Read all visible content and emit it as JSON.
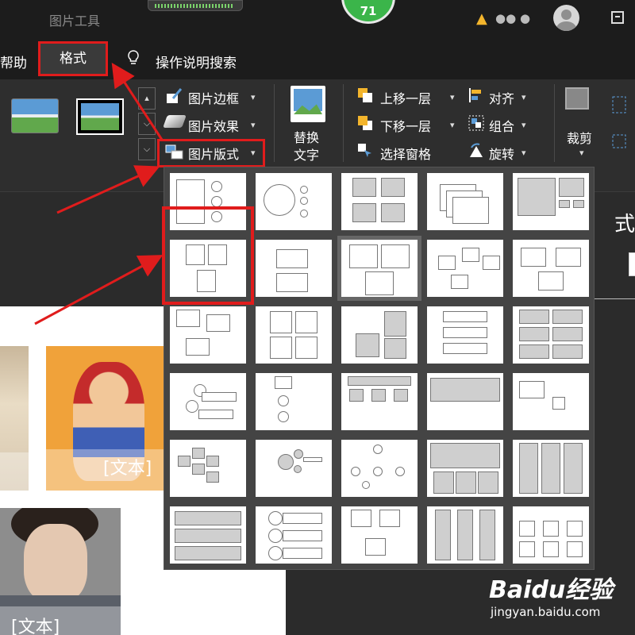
{
  "titlebar": {
    "tool_label": "图片工具",
    "score": "71",
    "user_name": "●● ●"
  },
  "menu": {
    "help": "帮助",
    "format": "格式",
    "search": "操作说明搜索"
  },
  "ribbon": {
    "border": "图片边框",
    "effects": "图片效果",
    "layout": "图片版式",
    "replace": "替换\n文字",
    "replace_line1": "替换",
    "replace_line2": "文字",
    "bring_forward": "上移一层",
    "send_backward": "下移一层",
    "selection_pane": "选择窗格",
    "align": "对齐",
    "group": "组合",
    "rotate": "旋转",
    "crop": "裁剪"
  },
  "slide": {
    "caption1": "[文本]",
    "caption2": "[文本]"
  },
  "right_panel": {
    "char": "式"
  },
  "watermark": {
    "brand": "Baidu经验",
    "url": "jingyan.baidu.com"
  },
  "layout_gallery": {
    "rows": 6,
    "cols": 5,
    "selected_index": 7,
    "highlighted_index": 5
  },
  "colors": {
    "accent_red": "#e01c1c",
    "ribbon_bg": "#2e2e2e",
    "titlebar_bg": "#1c1c1c",
    "score_green": "#3bb54a"
  }
}
